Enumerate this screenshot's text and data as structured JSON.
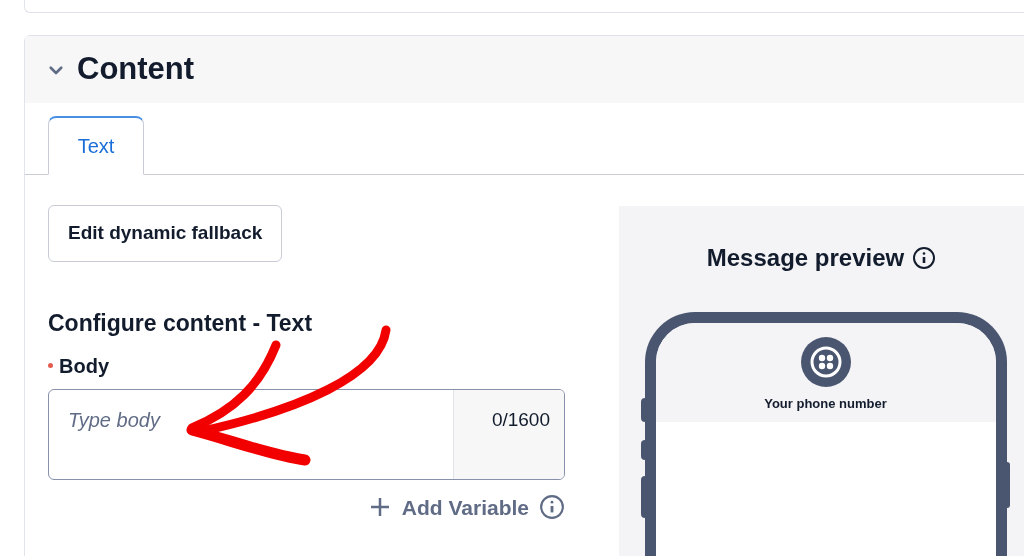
{
  "section": {
    "title": "Content",
    "expanded": true
  },
  "tabs": [
    {
      "label": "Text",
      "selected": true
    }
  ],
  "fallback_button": "Edit dynamic fallback",
  "form": {
    "heading": "Configure content - Text",
    "field": {
      "label": "Body",
      "required": true,
      "placeholder": "Type body",
      "counter": "0/1600"
    },
    "add_variable": "Add Variable"
  },
  "preview": {
    "title": "Message preview",
    "phone_label": "Your phone number"
  }
}
